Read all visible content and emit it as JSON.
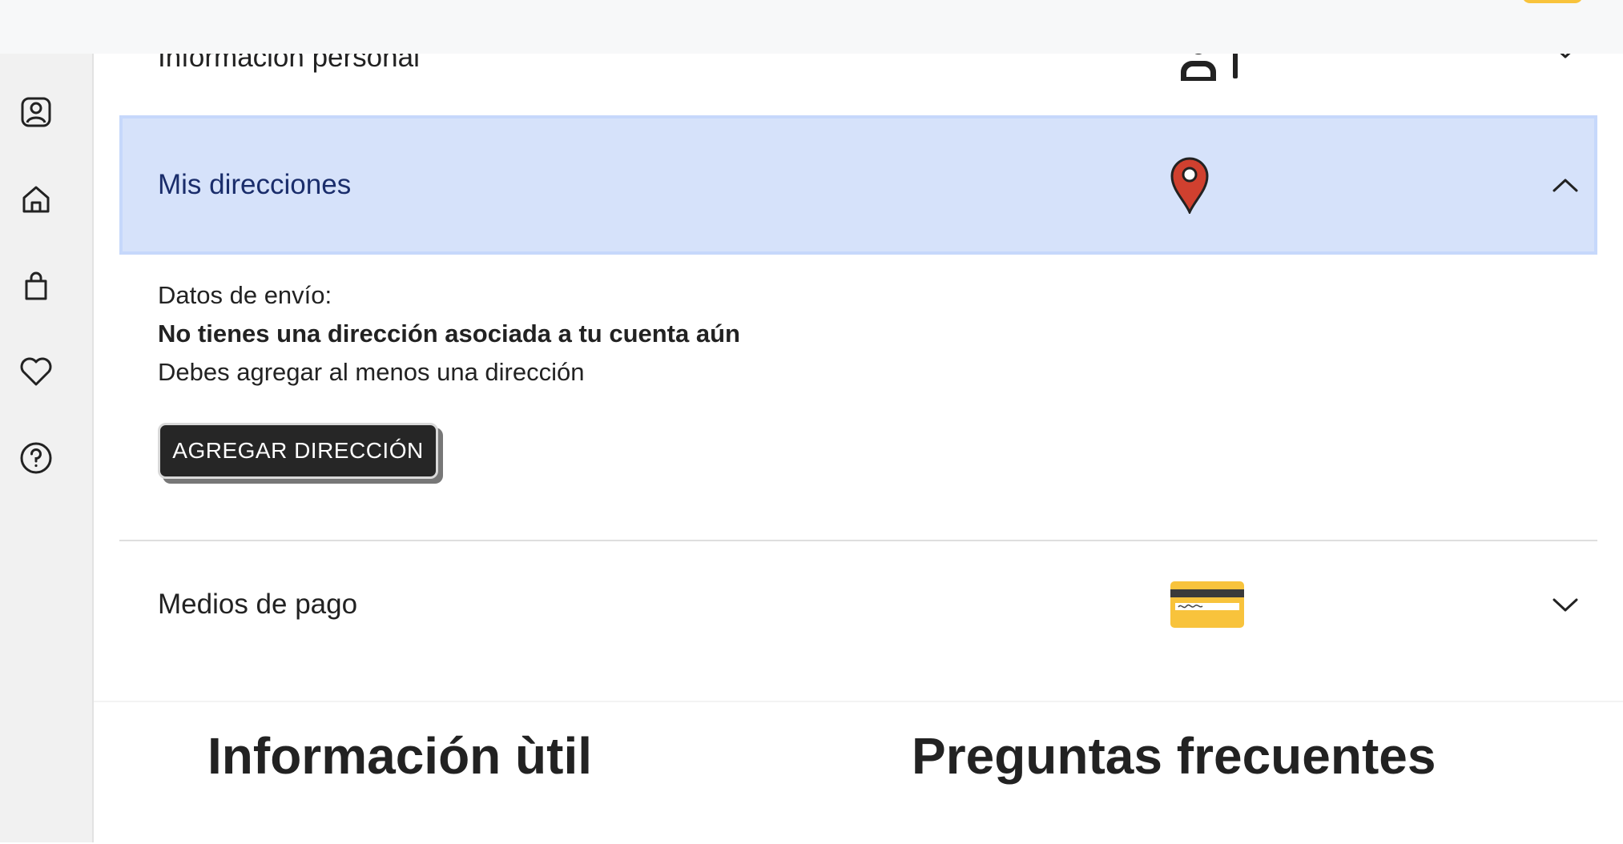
{
  "sidebar": {
    "items": [
      {
        "name": "profile",
        "icon": "user-badge-icon"
      },
      {
        "name": "home",
        "icon": "home-icon"
      },
      {
        "name": "orders",
        "icon": "shopping-bag-icon"
      },
      {
        "name": "favorites",
        "icon": "heart-icon"
      },
      {
        "name": "help",
        "icon": "question-circle-icon"
      }
    ]
  },
  "accordion": {
    "personal": {
      "title": "Información personal",
      "icon": "user-card-icon",
      "state": "collapsed"
    },
    "addresses": {
      "title": "Mis direcciones",
      "icon": "map-pin-icon",
      "state": "expanded",
      "shipping_label": "Datos de envío:",
      "empty_title": "No tienes una dirección asociada a tu cuenta aún",
      "empty_hint": "Debes agregar al menos una dirección",
      "add_button": "AGREGAR DIRECCIÓN"
    },
    "payments": {
      "title": "Medios de pago",
      "icon": "credit-card-icon",
      "state": "collapsed"
    }
  },
  "footer": {
    "info_title": "Información ùtil",
    "faq_title": "Preguntas frecuentes"
  },
  "colors": {
    "active_row_bg": "#d6e2fa",
    "active_row_text": "#1a2d6b",
    "pin": "#d0402f",
    "card": "#f8c33c",
    "button_bg": "#262626"
  }
}
